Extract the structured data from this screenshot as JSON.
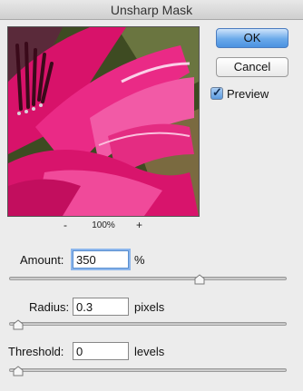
{
  "window": {
    "title": "Unsharp Mask"
  },
  "preview": {
    "zoom": "100%",
    "minus": "-",
    "plus": "+"
  },
  "buttons": {
    "ok": "OK",
    "cancel": "Cancel"
  },
  "preview_toggle": {
    "label": "Preview",
    "checked": true
  },
  "amount": {
    "label": "Amount:",
    "value": "350",
    "unit": "%",
    "level": 0.7
  },
  "radius": {
    "label": "Radius:",
    "value": "0.3",
    "unit": "pixels",
    "level": 0.0
  },
  "threshold": {
    "label": "Threshold:",
    "value": "0",
    "unit": "levels",
    "level": 0.0
  },
  "colors": {
    "ok_button": "#4b92e0",
    "focus_ring": "#8cb6ec",
    "flower": "#e0186e"
  }
}
